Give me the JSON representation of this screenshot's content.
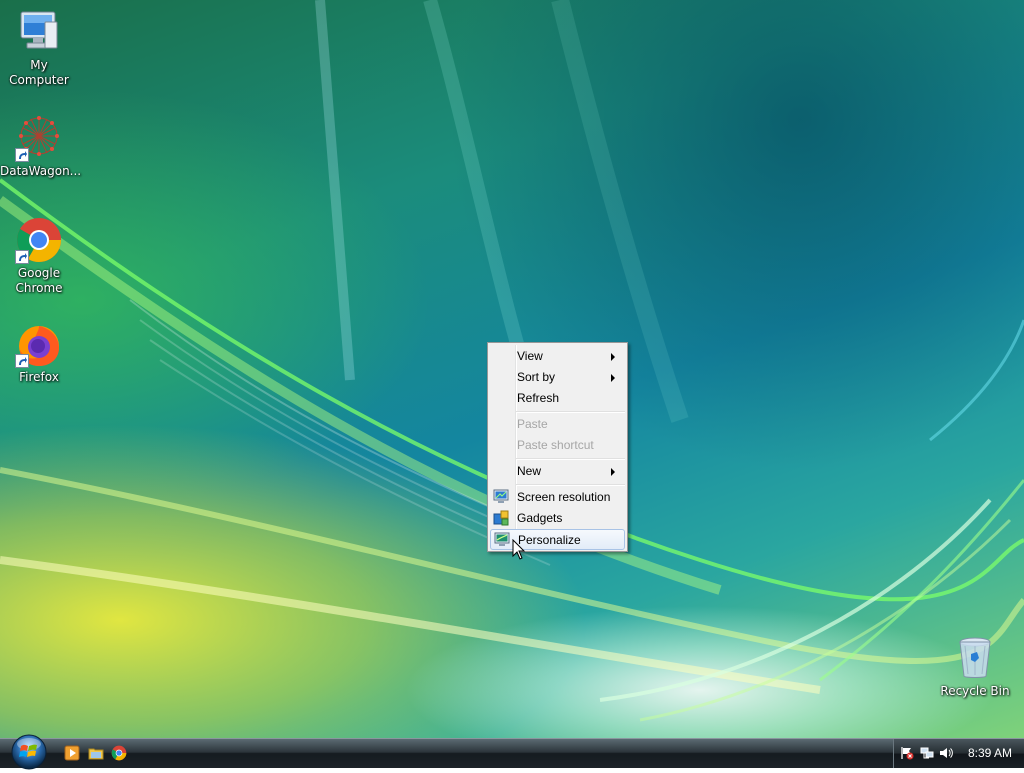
{
  "desktop": {
    "icons": [
      {
        "label": "My Computer",
        "icon": "computer-icon"
      },
      {
        "label": "DataWagon...",
        "icon": "datawagon-icon"
      },
      {
        "label": "Google Chrome",
        "icon": "chrome-icon"
      },
      {
        "label": "Firefox",
        "icon": "firefox-icon"
      },
      {
        "label": "Recycle Bin",
        "icon": "recycle-bin-icon"
      }
    ]
  },
  "context_menu": {
    "items": [
      {
        "label": "View",
        "submenu": true,
        "enabled": true
      },
      {
        "label": "Sort by",
        "submenu": true,
        "enabled": true
      },
      {
        "label": "Refresh",
        "submenu": false,
        "enabled": true
      },
      {
        "label": "Paste",
        "submenu": false,
        "enabled": false
      },
      {
        "label": "Paste shortcut",
        "submenu": false,
        "enabled": false
      },
      {
        "label": "New",
        "submenu": true,
        "enabled": true
      },
      {
        "label": "Screen resolution",
        "submenu": false,
        "enabled": true,
        "icon": "screen-resolution-icon"
      },
      {
        "label": "Gadgets",
        "submenu": false,
        "enabled": true,
        "icon": "gadgets-icon"
      },
      {
        "label": "Personalize",
        "submenu": false,
        "enabled": true,
        "icon": "personalize-icon",
        "highlighted": true
      }
    ]
  },
  "taskbar": {
    "start_icon": "windows-orb-icon",
    "quick_launch": [
      "media-player-icon",
      "folder-icon",
      "chrome-icon"
    ],
    "tray_icons": [
      "action-center-flag-icon",
      "network-icon",
      "volume-icon"
    ],
    "clock": "8:39 AM"
  },
  "colors": {
    "menu_background": "#f0f0f0",
    "menu_highlight_border": "#a8c3e6",
    "disabled_text": "#a6a6a6"
  }
}
